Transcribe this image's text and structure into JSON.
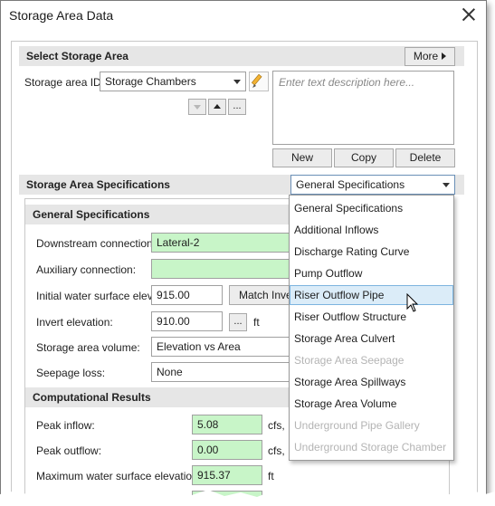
{
  "window": {
    "title": "Storage Area Data"
  },
  "select_section": {
    "title": "Select Storage Area",
    "more_label": "More",
    "id_label": "Storage area ID:",
    "id_value": "Storage Chambers",
    "description_placeholder": "Enter text description here...",
    "new_label": "New",
    "copy_label": "Copy",
    "delete_label": "Delete",
    "ellipsis_label": "..."
  },
  "specs_section": {
    "title": "Storage Area Specifications",
    "selected": "General Specifications"
  },
  "general": {
    "title": "General Specifications",
    "downstream_label": "Downstream connection:",
    "downstream_value": "Lateral-2",
    "auxiliary_label": "Auxiliary connection:",
    "auxiliary_value": "",
    "initial_ws_label": "Initial water surface elev:",
    "initial_ws_value": "915.00",
    "match_invert_label": "Match Invert",
    "invert_label": "Invert elevation:",
    "invert_value": "910.00",
    "invert_unit": "ft",
    "volume_label": "Storage area volume:",
    "volume_value": "Elevation vs Area",
    "seepage_label": "Seepage loss:",
    "seepage_value": "None"
  },
  "results": {
    "title": "Computational Results",
    "peak_inflow_label": "Peak inflow:",
    "peak_inflow_value": "5.08",
    "peak_inflow_unit": "cfs,",
    "peak_outflow_label": "Peak outflow:",
    "peak_outflow_value": "0.00",
    "peak_outflow_unit": "cfs,",
    "max_ws_label": "Maximum water surface elevation:",
    "max_ws_value": "915.37",
    "max_ws_unit": "ft"
  },
  "dropdown_options": [
    {
      "label": "General Specifications",
      "enabled": true
    },
    {
      "label": "Additional Inflows",
      "enabled": true
    },
    {
      "label": "Discharge Rating Curve",
      "enabled": true
    },
    {
      "label": "Pump Outflow",
      "enabled": true
    },
    {
      "label": "Riser Outflow Pipe",
      "enabled": true,
      "hovered": true
    },
    {
      "label": "Riser Outflow Structure",
      "enabled": true
    },
    {
      "label": "Storage Area Culvert",
      "enabled": true
    },
    {
      "label": "Storage Area Seepage",
      "enabled": false
    },
    {
      "label": "Storage Area Spillways",
      "enabled": true
    },
    {
      "label": "Storage Area Volume",
      "enabled": true
    },
    {
      "label": "Underground Pipe Gallery",
      "enabled": false
    },
    {
      "label": "Underground Storage Chamber",
      "enabled": false
    }
  ],
  "colors": {
    "input_green": "#c8f5c8",
    "hover_highlight": "#dbecf8",
    "section_bar": "#e6e6e6"
  }
}
